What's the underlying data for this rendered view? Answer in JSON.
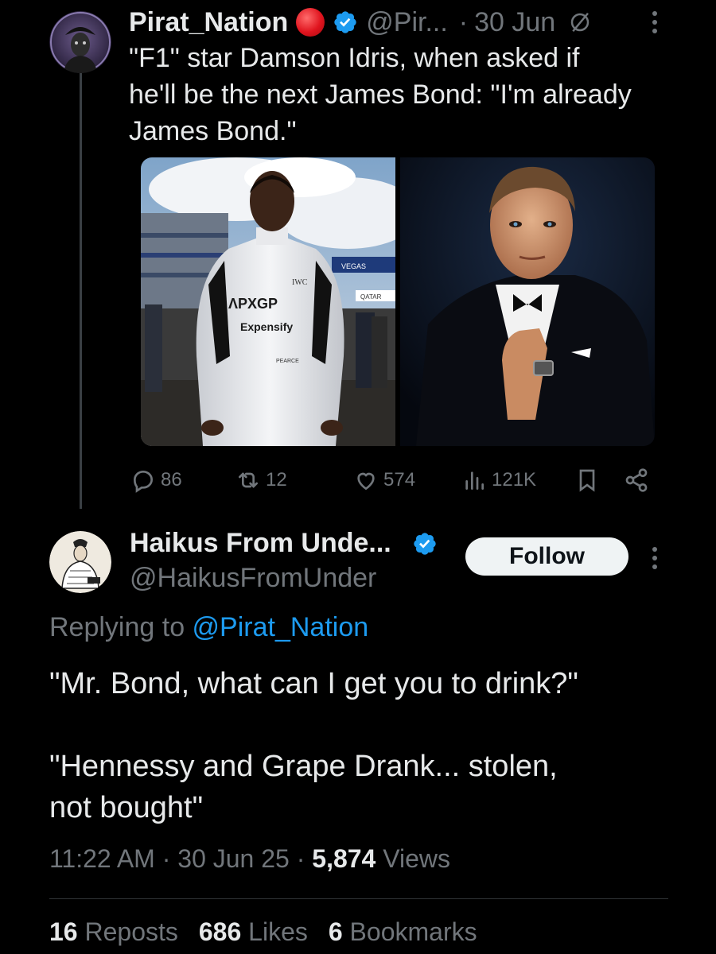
{
  "parent_tweet": {
    "author_name": "Pirat_Nation",
    "handle": "@Pir...",
    "separator": "·",
    "date": "30 Jun",
    "text": "\"F1\" star Damson Idris, when asked if\nhe'll be the next James Bond: \"I'm already\nJames Bond.\"",
    "media": {
      "left_image_text": [
        "VEGAS",
        "QATAR",
        "IWC",
        "Expensify",
        "PEARCE"
      ],
      "right_image": "portrait-in-tuxedo"
    },
    "stats": {
      "replies": "86",
      "reposts": "12",
      "likes": "574",
      "views": "121K"
    },
    "icons": [
      "reply-icon",
      "repost-icon",
      "like-icon",
      "views-icon",
      "bookmark-icon",
      "share-icon",
      "grok-icon",
      "more-icon"
    ]
  },
  "reply_tweet": {
    "author_name": "Haikus From Unde...",
    "handle": "@HaikusFromUnder",
    "follow_label": "Follow",
    "replying_prefix": "Replying to ",
    "replying_mention": "@Pirat_Nation",
    "text": "\"Mr. Bond, what can I get you to drink?\"\n\n\"Hennessy and Grape Drank... stolen,\nnot bought\"",
    "time": "11:22 AM",
    "date": "30 Jun 25",
    "views_count": "5,874",
    "views_label": "Views",
    "reposts_count": "16",
    "reposts_label": "Reposts",
    "likes_count": "686",
    "likes_label": "Likes",
    "bookmarks_count": "6",
    "bookmarks_label": "Bookmarks"
  },
  "colors": {
    "background": "#000000",
    "text": "#e7e9ea",
    "muted": "#71767b",
    "link": "#1d9bf0",
    "verified": "#1d9bf0",
    "live_dot": "#e0141e",
    "divider": "#2f3336"
  }
}
